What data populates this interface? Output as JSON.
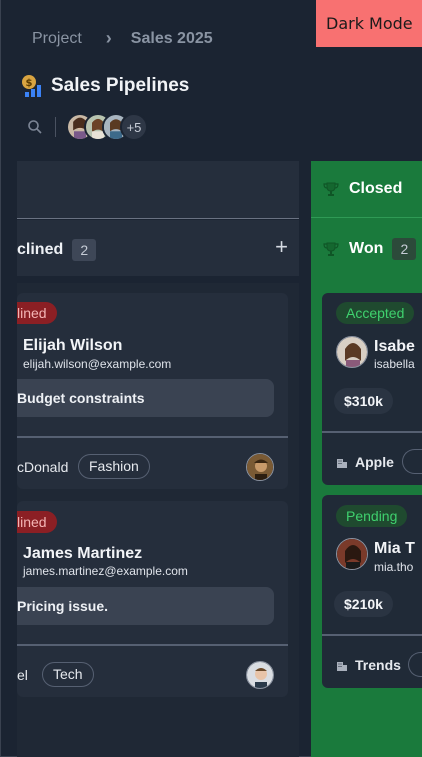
{
  "dark_mode_label": "Dark Mode",
  "breadcrumb": {
    "root": "Project",
    "current": "Sales 2025"
  },
  "page": {
    "title": "Sales Pipelines"
  },
  "toolbar": {
    "more_members": "+5"
  },
  "columns": {
    "declined": {
      "label": "clined",
      "count": "2",
      "add": "+",
      "cards": [
        {
          "status": "lined",
          "name": "Elijah Wilson",
          "email": "elijah.wilson@example.com",
          "note": "Budget constraints",
          "company": "cDonald",
          "tag": "Fashion"
        },
        {
          "status": "lined",
          "name": "James Martinez",
          "email": "james.martinez@example.com",
          "note": "Pricing issue.",
          "company": "el",
          "tag": "Tech"
        }
      ]
    },
    "closed_won": {
      "group_label": "Closed",
      "label": "Won",
      "count": "2",
      "cards": [
        {
          "status": "Accepted",
          "name": "Isabe",
          "email": "isabella",
          "amount": "$310k",
          "company": "Apple"
        },
        {
          "status": "Pending",
          "name": "Mia T",
          "email": "mia.tho",
          "amount": "$210k",
          "company": "Trends"
        }
      ]
    }
  },
  "colors": {
    "background": "#1b2432",
    "won_column": "#1a7a3c",
    "declined_badge": "#8b1f24",
    "accent_toggle": "#f87171"
  }
}
